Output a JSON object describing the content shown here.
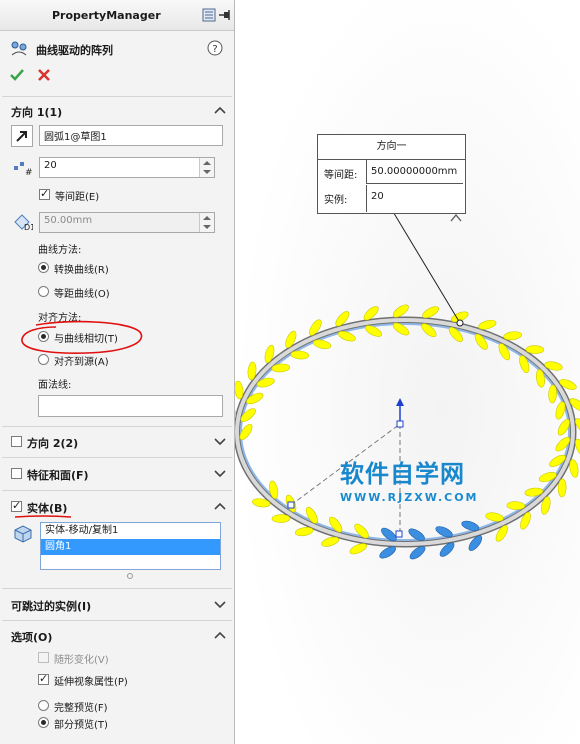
{
  "panel": {
    "title": "PropertyManager",
    "feature_title": "曲线驱动的阵列",
    "help": "?"
  },
  "direction1": {
    "header": "方向 1(1)",
    "path": "圆弧1@草图1",
    "instances": "20",
    "equal_spacing_label": "等间距(E)",
    "equal_spacing_checked": true,
    "spacing": "50.00mm",
    "curve_method_label": "曲线方法:",
    "curve_method_options": [
      "转换曲线(R)",
      "等距曲线(O)"
    ],
    "curve_method_selected": 0,
    "alignment_label": "对齐方法:",
    "alignment_options": [
      "与曲线相切(T)",
      "对齐到源(A)"
    ],
    "alignment_selected": 0,
    "face_normal_label": "面法线:",
    "face_normal_value": ""
  },
  "direction2": {
    "header": "方向 2(2)",
    "checked": false
  },
  "features_faces": {
    "header": "特征和面(F)",
    "checked": false
  },
  "bodies": {
    "header": "实体(B)",
    "checked": true,
    "items": [
      "实体-移动/复制1",
      "圆角1"
    ],
    "selected_index": 1
  },
  "instances_to_skip": {
    "header": "可跳过的实例(I)"
  },
  "options": {
    "header": "选项(O)",
    "vary_sketch_label": "随形变化(V)",
    "vary_sketch_checked": false,
    "propagate_label": "延伸视象属性(P)",
    "propagate_checked": true,
    "full_preview_label": "完整预览(F)",
    "partial_preview_label": "部分预览(T)",
    "preview_selected": 1
  },
  "callout": {
    "title": "方向一",
    "spacing_label": "等间距:",
    "spacing_value": "50.00000000mm",
    "instances_label": "实例:",
    "instances_value": "20"
  },
  "watermark": {
    "main": "软件自学网",
    "sub": "WWW.RJZXW.COM"
  },
  "colors": {
    "accept": "#3aa54a",
    "cancel": "#d8332c",
    "annotation": "#e01010",
    "leaf_yellow": "#ffff00",
    "leaf_blue": "#3b8ee0",
    "ring": "#8fb8e8",
    "selection": "#3399ff"
  },
  "icons": [
    "pushpin-icon",
    "curve-pattern-icon",
    "ok-check-icon",
    "cancel-x-icon",
    "direction-arrow-icon",
    "instances-icon",
    "spacing-icon",
    "body-icon",
    "triad-icon"
  ]
}
